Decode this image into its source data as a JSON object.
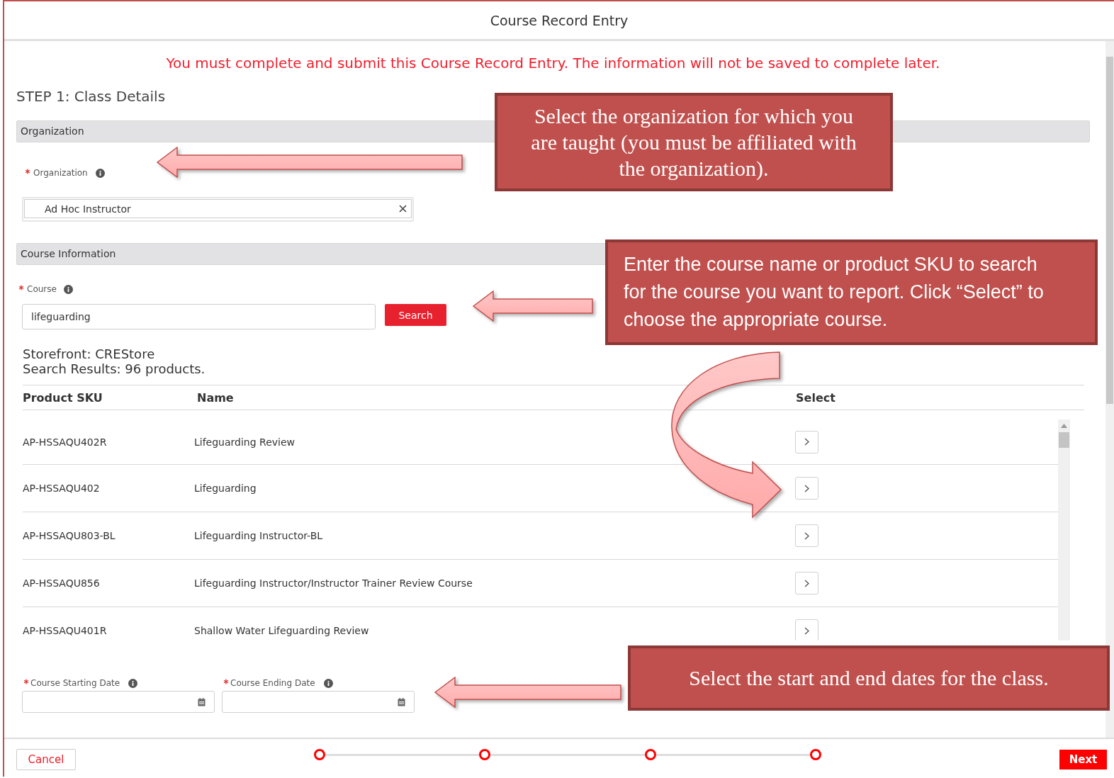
{
  "window": {
    "title": "Course Record Entry"
  },
  "notice": "You must complete and submit this Course Record Entry. The information will not be saved to complete later.",
  "step_title": "STEP 1: Class Details",
  "organization_section": {
    "heading": "Organization",
    "label": "Organization",
    "required": true,
    "value": "Ad Hoc Instructor"
  },
  "course_section": {
    "heading": "Course Information",
    "label": "Course",
    "required": true,
    "value": "lifeguarding",
    "search_button": "Search"
  },
  "results": {
    "storefront": "Storefront: CREStore",
    "summary": "Search Results: 96 products.",
    "columns": [
      "Product SKU",
      "Name",
      "Select"
    ],
    "rows": [
      {
        "sku": "AP-HSSAQU402R",
        "name": "Lifeguarding Review"
      },
      {
        "sku": "AP-HSSAQU402",
        "name": "Lifeguarding"
      },
      {
        "sku": "AP-HSSAQU803-BL",
        "name": "Lifeguarding Instructor-BL"
      },
      {
        "sku": "AP-HSSAQU856",
        "name": "Lifeguarding Instructor/Instructor Trainer Review Course"
      },
      {
        "sku": "AP-HSSAQU401R",
        "name": "Shallow Water Lifeguarding Review"
      }
    ]
  },
  "dates": [
    {
      "label": "Course Starting Date",
      "required": true
    },
    {
      "label": "Course Ending Date",
      "required": true
    }
  ],
  "footer": {
    "cancel": "Cancel",
    "steps": [
      {
        "kind": "ring"
      },
      {
        "kind": "ring"
      },
      {
        "kind": "ring"
      },
      {
        "kind": "ring"
      }
    ],
    "next": "Next"
  },
  "callouts": {
    "organization": "Select the organization for which you are taught (you must be affiliated with the organization).",
    "course": "Enter the course name or product SKU to search for the course you want to report. Click “Select” to choose the appropriate course.",
    "dates": "Select the start and end dates for the class."
  }
}
